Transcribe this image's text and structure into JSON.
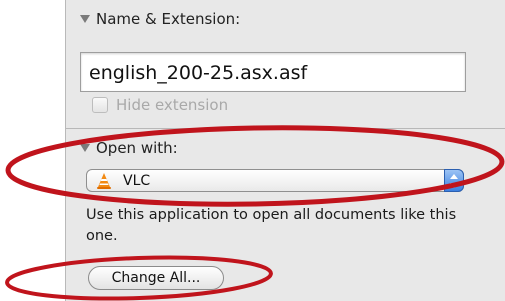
{
  "name_extension": {
    "header": "Name & Extension:",
    "filename": "english_200-25.asx.asf",
    "hide_extension_label": "Hide extension",
    "hide_extension_checked": false
  },
  "open_with": {
    "header": "Open with:",
    "selected_app": "VLC",
    "app_icon": "vlc-cone-icon",
    "description": "Use this application to open all documents like this one.",
    "change_all_label": "Change All..."
  },
  "annotations": {
    "ellipse_color": "#c0141c",
    "ellipses": [
      "open-with-highlight",
      "change-all-highlight"
    ]
  }
}
